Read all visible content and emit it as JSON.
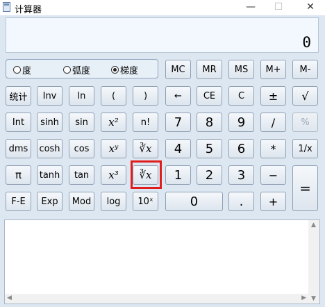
{
  "window": {
    "title": "计算器",
    "minimize": "—",
    "maximize": "☐",
    "close": "✕"
  },
  "display": {
    "value": "0"
  },
  "angle": {
    "options": [
      "度",
      "弧度",
      "梯度"
    ],
    "selected": "梯度"
  },
  "memory": [
    "MC",
    "MR",
    "MS",
    "M+",
    "M-"
  ],
  "rows": {
    "r1": [
      "统计",
      "Inv",
      "ln",
      "(",
      ")",
      "←",
      "CE",
      "C",
      "±",
      "√"
    ],
    "r2": [
      "Int",
      "sinh",
      "sin",
      "x²",
      "n!",
      "7",
      "8",
      "9",
      "/",
      "%"
    ],
    "r3": [
      "dms",
      "cosh",
      "cos",
      "xʸ",
      "∛x",
      "4",
      "5",
      "6",
      "*",
      "1/x"
    ],
    "r4": [
      "π",
      "tanh",
      "tan",
      "x³",
      "∛x",
      "1",
      "2",
      "3",
      "−",
      "="
    ],
    "r5": [
      "F-E",
      "Exp",
      "Mod",
      "log",
      "10ˣ",
      "0",
      ".",
      "+"
    ]
  },
  "disabled": [
    "%"
  ],
  "colors": {
    "highlight": "#e01d1d",
    "background": "#dde7f2"
  }
}
